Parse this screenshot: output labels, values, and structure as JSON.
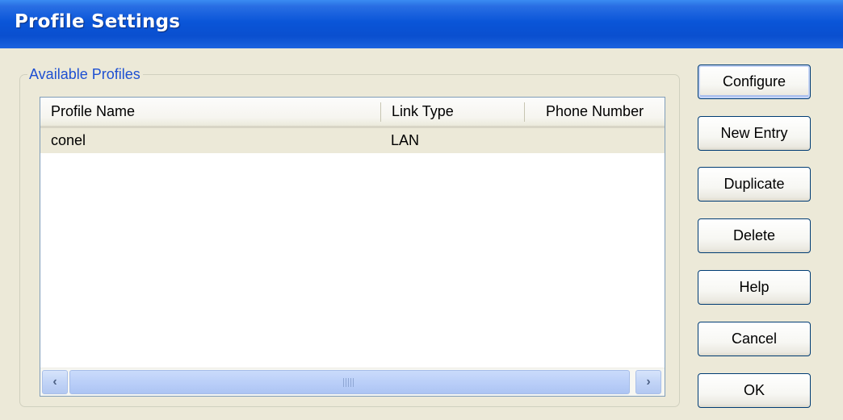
{
  "window": {
    "title": "Profile Settings"
  },
  "group": {
    "legend": "Available Profiles"
  },
  "list": {
    "columns": [
      "Profile Name",
      "Link Type",
      "Phone Number"
    ],
    "rows": [
      {
        "profile_name": "conel",
        "link_type": "LAN",
        "phone_number": ""
      }
    ]
  },
  "buttons": {
    "configure": "Configure",
    "new_entry": "New Entry",
    "duplicate": "Duplicate",
    "delete": "Delete",
    "help": "Help",
    "cancel": "Cancel",
    "ok": "OK"
  },
  "icons": {
    "scroll_left": "chevron-left-icon",
    "scroll_right": "chevron-right-icon",
    "scroll_grip": "grip-icon"
  },
  "colors": {
    "titlebar": "#0a55d8",
    "legend_text": "#1e50d2",
    "selected_row": "#ece9d8",
    "button_border": "#003c74"
  }
}
